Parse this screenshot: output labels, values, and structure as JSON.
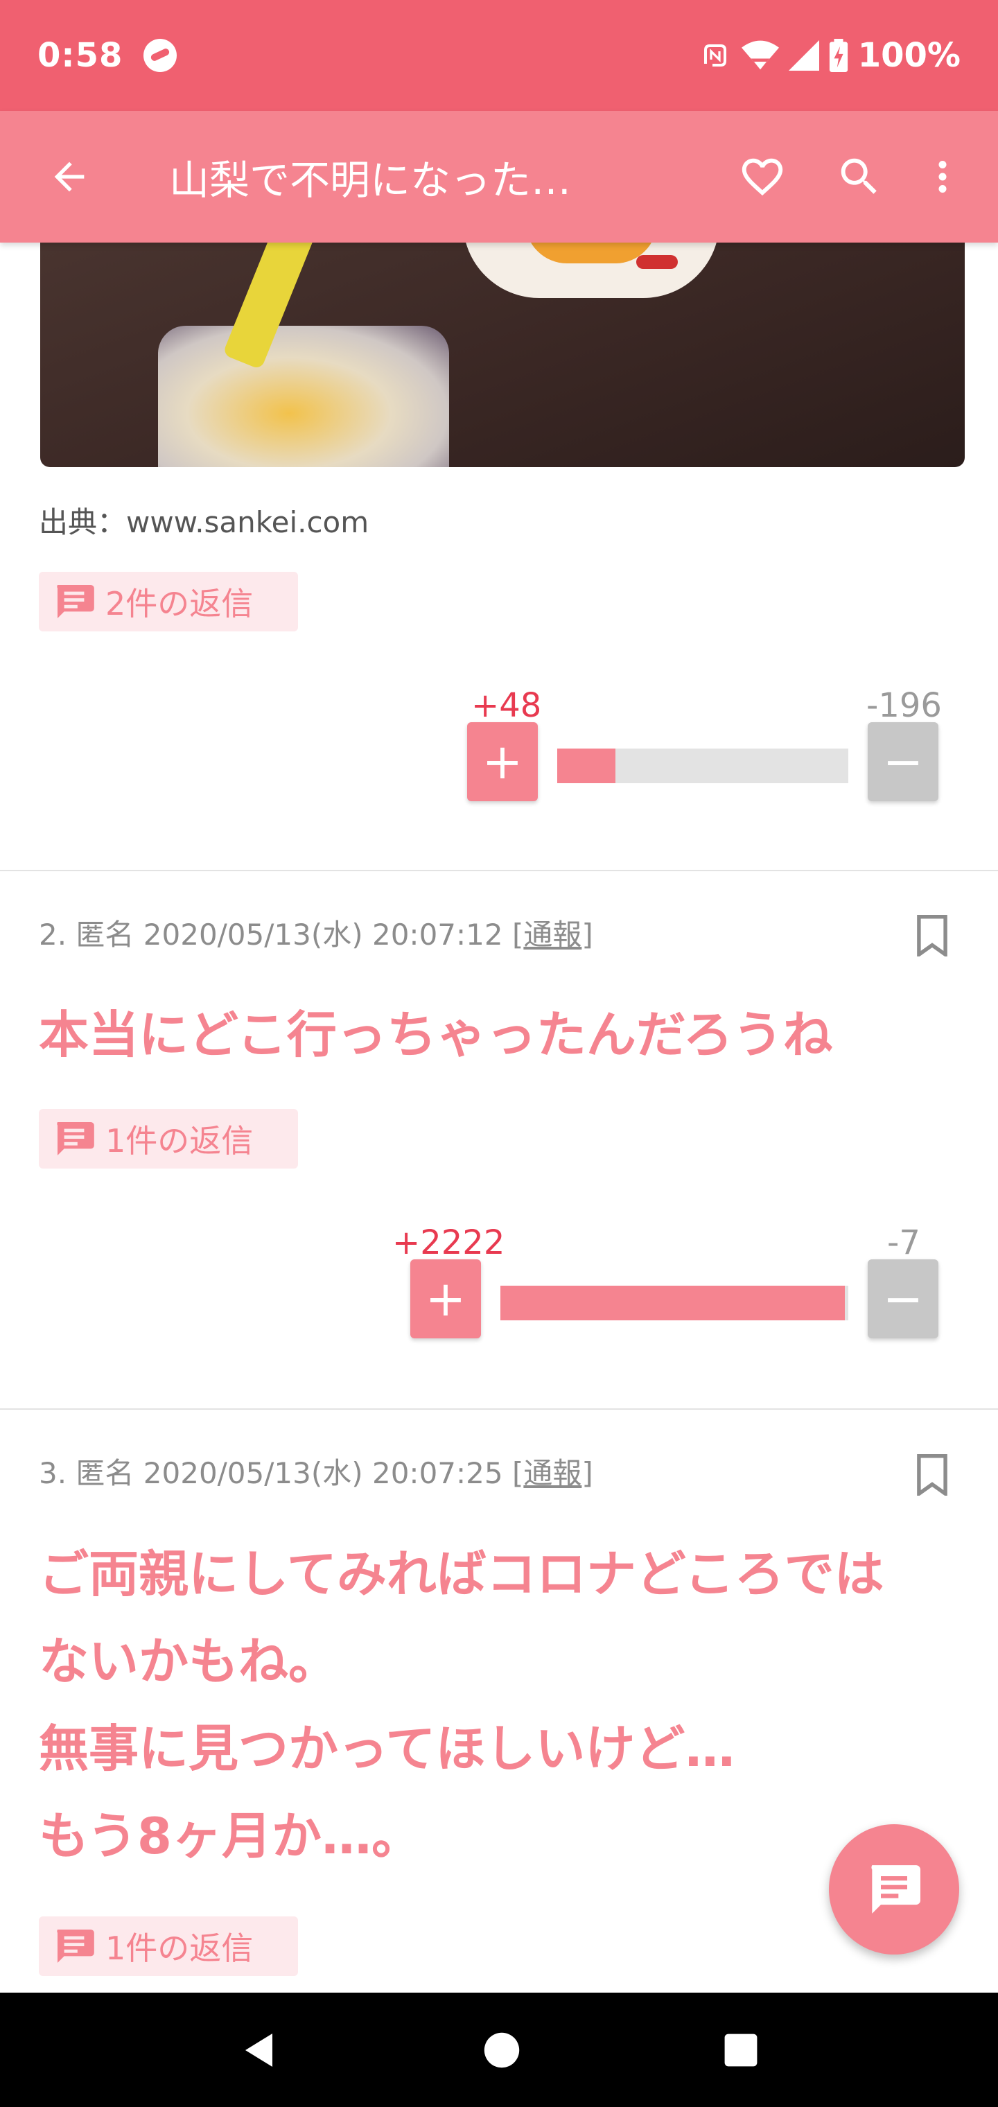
{
  "status_bar": {
    "time": "0:58",
    "battery": "100%"
  },
  "app_bar": {
    "title": "山梨で不明になった…"
  },
  "post1": {
    "source": "出典：www.sankei.com",
    "replies": "2件の返信",
    "plus": "+48",
    "minus": "-196",
    "ratio": 0.2
  },
  "post2": {
    "meta_prefix": "2. 匿名 2020/05/13(水) 20:07:12 [",
    "report": "通報",
    "meta_suffix": "]",
    "body": "本当にどこ行っちゃったんだろうね",
    "replies": "1件の返信",
    "plus": "+2222",
    "minus": "-7",
    "ratio": 0.99
  },
  "post3": {
    "meta_prefix": "3. 匿名 2020/05/13(水) 20:07:25 [",
    "report": "通報",
    "meta_suffix": "]",
    "body_lines": [
      "ご両親にしてみればコロナどころでは",
      "ないかもね。",
      "無事に見つかってほしいけど…",
      "もう8ヶ月か…。"
    ],
    "replies": "1件の返信"
  },
  "icons": {
    "back": "arrow-back-icon",
    "favorite": "heart-icon",
    "search": "search-icon",
    "menu": "more-vert-icon",
    "comment": "comment-icon",
    "bookmark": "bookmark-icon",
    "fab": "comment-fab-icon"
  },
  "colors": {
    "status_bar": "#f06070",
    "app_bar": "#f58490",
    "accent": "#f58490",
    "plus": "#e83a50"
  }
}
